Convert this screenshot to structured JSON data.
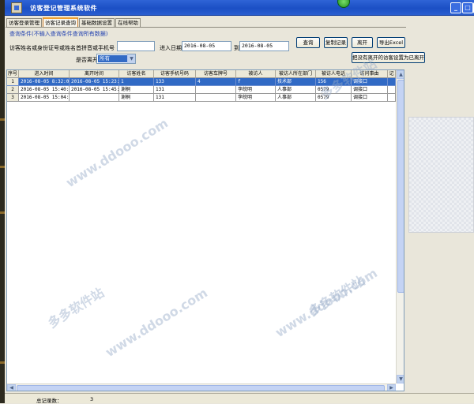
{
  "window": {
    "title": "访客登记管理系统软件"
  },
  "tabs": [
    {
      "label": "访客登录管理",
      "active": false
    },
    {
      "label": "访客记录查询",
      "active": true
    },
    {
      "label": "基础数据设置",
      "active": false
    },
    {
      "label": "在线帮助",
      "active": false
    }
  ],
  "query": {
    "hint": "查询条件(不输入查询条件查询所有数据)",
    "name_label": "访客姓名或身份证号或姓名首拼音或手机号",
    "name_value": "",
    "date_label": "进入日期从",
    "date_from": "2016-08-05",
    "to_label": "到",
    "date_to": "2016-08-05",
    "left_label": "是否离开",
    "left_value": "所有"
  },
  "buttons": {
    "search": "查询",
    "copy": "复制记录",
    "leave": "离开",
    "export": "导出Excel",
    "set_all_left": "把没有离开的访客设置为已离开"
  },
  "table": {
    "headers": [
      "序号",
      "进入时间",
      "离开时间",
      "访客姓名",
      "访客手机号码",
      "访客车牌号",
      "被访人",
      "被访人所在部门",
      "被访人电话",
      "访问事由",
      "记"
    ],
    "rows": [
      {
        "index": "1",
        "enter": "2016-08-05 8:32:01",
        "leave": "2016-08-05 15:23:11",
        "name": "1",
        "phone": "133",
        "plate": "4",
        "host": "f",
        "dept": "技术部",
        "host_phone": "156",
        "reason": "调接口",
        "note": ""
      },
      {
        "index": "2",
        "enter": "2016-08-05 15:40:19",
        "leave": "2016-08-05 15:45:35",
        "name": "谢桐",
        "phone": "131",
        "plate": "",
        "host": "李皖明",
        "dept": "人事部",
        "host_phone": "0579",
        "reason": "调接口",
        "note": ""
      },
      {
        "index": "3",
        "enter": "2016-08-05 15:04:30",
        "leave": "",
        "name": "谢桐",
        "phone": "131",
        "plate": "",
        "host": "李皖明",
        "dept": "人事部",
        "host_phone": "0579",
        "reason": "调接口",
        "note": ""
      }
    ]
  },
  "status": {
    "total_label": "总记录数：",
    "total_value": "3"
  },
  "watermarks": [
    "www.ddooo.com",
    "多多软件站"
  ],
  "colors": {
    "titlebar": "#1b4fc4",
    "selection": "#316ac5",
    "hint": "#1f3fb0"
  }
}
